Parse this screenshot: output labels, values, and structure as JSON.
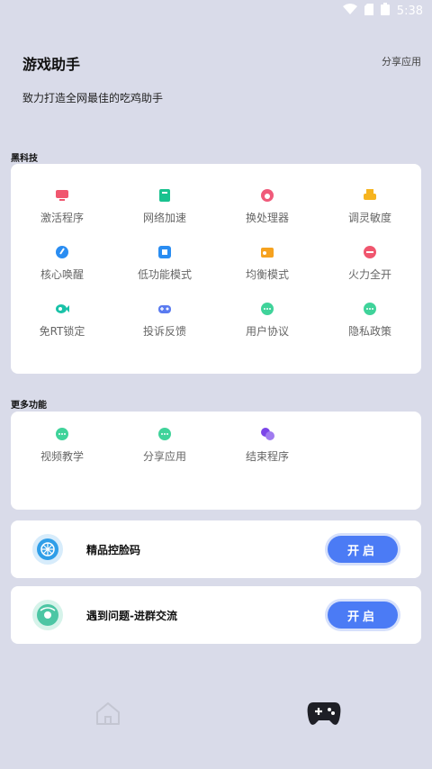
{
  "status_bar": {
    "time": "5:38"
  },
  "header": {
    "title": "游戏助手",
    "share_label": "分享应用",
    "subtitle": "致力打造全网最佳的吃鸡助手"
  },
  "sections": {
    "tech_label": "黑科技",
    "more_label": "更多功能"
  },
  "tech_items": [
    {
      "label": "激活程序",
      "icon": "monitor-icon",
      "color": "#f0566e"
    },
    {
      "label": "网络加速",
      "icon": "book-icon",
      "color": "#19c28f"
    },
    {
      "label": "换处理器",
      "icon": "cpu-icon",
      "color": "#f05a7a"
    },
    {
      "label": "调灵敏度",
      "icon": "printer-icon",
      "color": "#f6b41f"
    },
    {
      "label": "核心唤醒",
      "icon": "brush-icon",
      "color": "#2a8df2"
    },
    {
      "label": "低功能模式",
      "icon": "chip-icon",
      "color": "#2a8df2"
    },
    {
      "label": "均衡模式",
      "icon": "radio-icon",
      "color": "#f6a21f"
    },
    {
      "label": "火力全开",
      "icon": "gamepad-small-icon",
      "color": "#f0566e"
    },
    {
      "label": "免RT锁定",
      "icon": "fish-icon",
      "color": "#19c2a8"
    },
    {
      "label": "投诉反馈",
      "icon": "controller-icon",
      "color": "#5a7bf0"
    },
    {
      "label": "用户协议",
      "icon": "chat-icon",
      "color": "#3fd39a"
    },
    {
      "label": "隐私政策",
      "icon": "chat-icon",
      "color": "#3fd39a"
    }
  ],
  "more_items": [
    {
      "label": "视频教学",
      "icon": "chat-icon",
      "color": "#3fd39a"
    },
    {
      "label": "分享应用",
      "icon": "chat-icon",
      "color": "#3fd39a"
    },
    {
      "label": "结束程序",
      "icon": "bubbles-icon",
      "color": "#7b45e8"
    }
  ],
  "rows": [
    {
      "label": "精品控脸码",
      "button": "开启",
      "icon": "wheel-icon",
      "color": "#2f9ee8"
    },
    {
      "label": "遇到问题-进群交流",
      "button": "开启",
      "icon": "disc-icon",
      "color": "#4cc6a4"
    }
  ]
}
